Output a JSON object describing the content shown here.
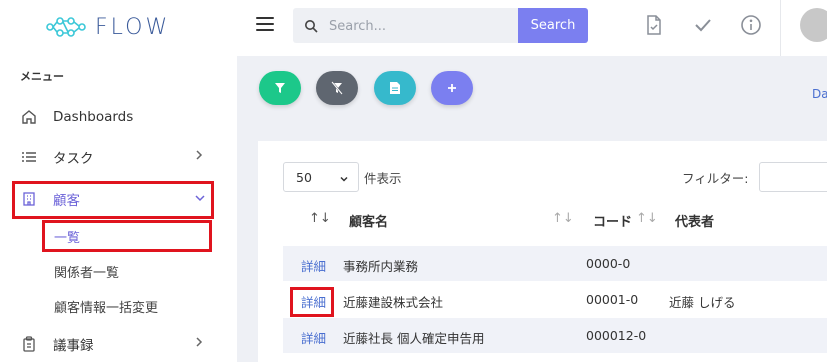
{
  "logo": {
    "text": "FLOW"
  },
  "sidebar": {
    "menu_title": "メニュー",
    "items": [
      {
        "label": "Dashboards"
      },
      {
        "label": "タスク"
      },
      {
        "label": "顧客"
      },
      {
        "label": "議事録"
      }
    ],
    "sub_items": [
      {
        "label": "一覧"
      },
      {
        "label": "関係者一覧"
      },
      {
        "label": "顧客情報一括変更"
      }
    ]
  },
  "topbar": {
    "search_placeholder": "Search...",
    "search_button": "Search"
  },
  "actions": {
    "link_partial": "Da"
  },
  "table_controls": {
    "page_length": "50",
    "page_length_label": "件表示",
    "filter_label": "フィルター:"
  },
  "table": {
    "columns": [
      "顧客名",
      "コード",
      "代表者"
    ],
    "rows": [
      {
        "action": "詳細",
        "name": "事務所内業務",
        "code": "0000-0",
        "rep": ""
      },
      {
        "action": "詳細",
        "name": "近藤建設株式会社",
        "code": "00001-0",
        "rep": "近藤 しげる"
      },
      {
        "action": "詳細",
        "name": "近藤社長 個人確定申告用",
        "code": "000012-0",
        "rep": ""
      }
    ]
  },
  "colors": {
    "accent": "#7b7ff0",
    "active": "#6c63d8",
    "highlight": "#e0141e",
    "btn_green": "#1cc88a",
    "btn_gray": "#5f6670",
    "btn_cyan": "#36b9cc",
    "btn_purple": "#7b7ff0"
  }
}
